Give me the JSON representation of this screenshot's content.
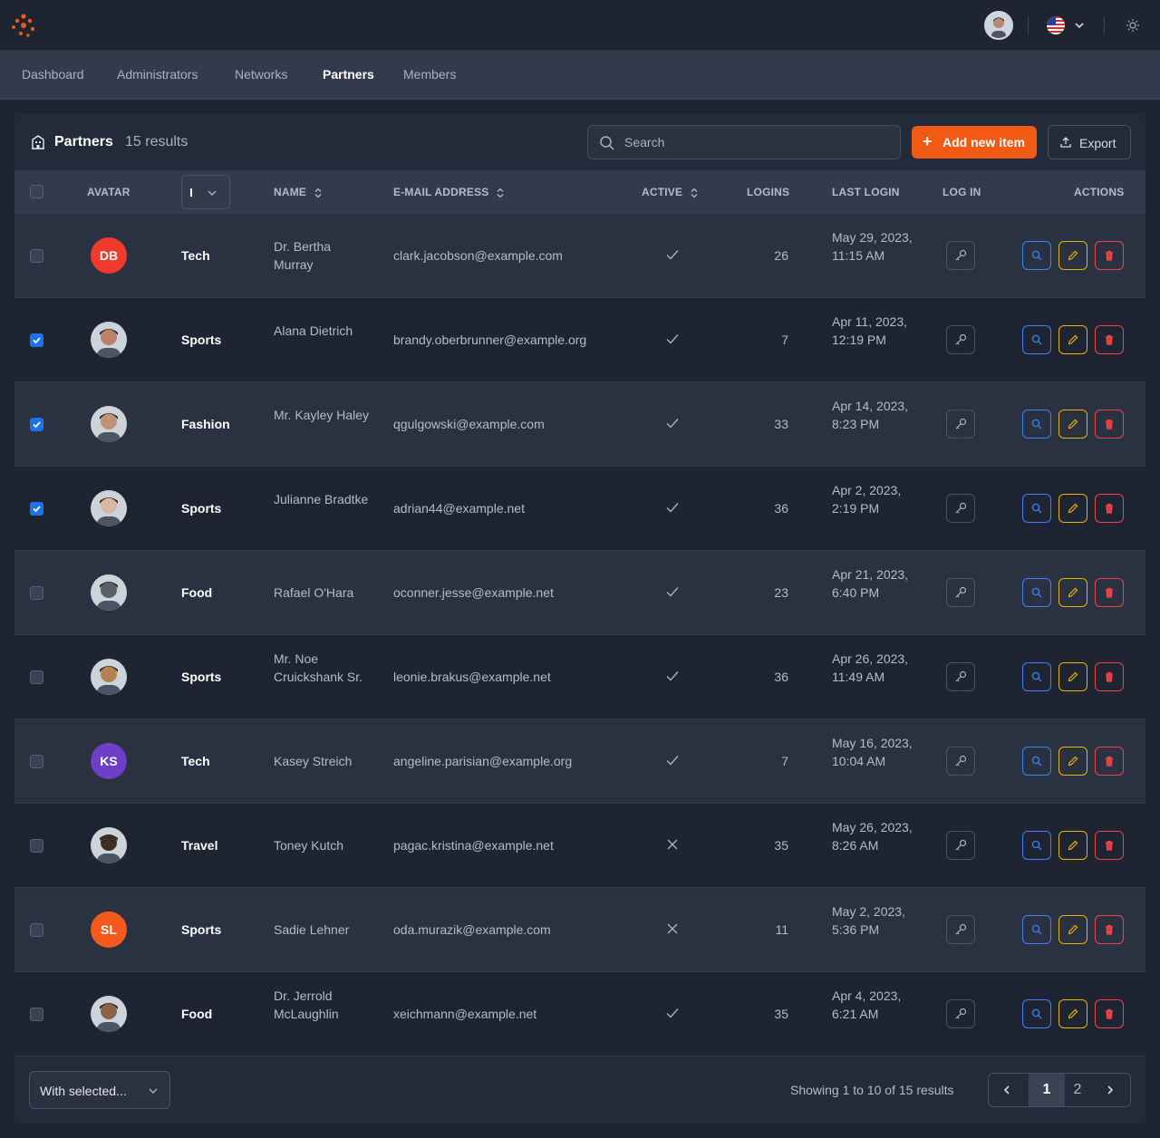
{
  "nav": {
    "items": [
      {
        "label": "Dashboard",
        "active": false
      },
      {
        "label": "Administrators",
        "active": false
      },
      {
        "label": "Networks",
        "active": false
      },
      {
        "label": "Partners",
        "active": true
      },
      {
        "label": "Members",
        "active": false
      }
    ]
  },
  "card": {
    "title": "Partners",
    "count": "15 results",
    "search_placeholder": "Search",
    "add_label": "Add new item",
    "export_label": "Export"
  },
  "columns": {
    "avatar": "AVATAR",
    "name": "NAME",
    "email": "E-MAIL ADDRESS",
    "active": "ACTIVE",
    "logins": "LOGINS",
    "last_login": "LAST LOGIN",
    "log_in": "LOG IN",
    "actions": "ACTIONS"
  },
  "rows": [
    {
      "checked": false,
      "avatar": {
        "type": "initials",
        "text": "DB",
        "color": "#ef3b2d"
      },
      "category": "Tech",
      "name": "Dr. Bertha Murray",
      "email": "clark.jacobson@example.com",
      "active": true,
      "logins": "26",
      "last_login": "May 29, 2023, 11:15 AM"
    },
    {
      "checked": true,
      "avatar": {
        "type": "photo",
        "color": "#b9826a"
      },
      "category": "Sports",
      "name": "Alana Dietrich",
      "email": "brandy.oberbrunner@example.org",
      "active": true,
      "logins": "7",
      "last_login": "Apr 11, 2023, 12:19 PM"
    },
    {
      "checked": true,
      "avatar": {
        "type": "photo",
        "color": "#c2917a"
      },
      "category": "Fashion",
      "name": "Mr. Kayley Haley",
      "email": "qgulgowski@example.com",
      "active": true,
      "logins": "33",
      "last_login": "Apr 14, 2023, 8:23 PM"
    },
    {
      "checked": true,
      "avatar": {
        "type": "photo",
        "color": "#d9b8a4"
      },
      "category": "Sports",
      "name": "Julianne Bradtke",
      "email": "adrian44@example.net",
      "active": true,
      "logins": "36",
      "last_login": "Apr 2, 2023, 2:19 PM"
    },
    {
      "checked": false,
      "avatar": {
        "type": "photo",
        "color": "#5b6068"
      },
      "category": "Food",
      "name": "Rafael O'Hara",
      "email": "oconner.jesse@example.net",
      "active": true,
      "logins": "23",
      "last_login": "Apr 21, 2023, 6:40 PM"
    },
    {
      "checked": false,
      "avatar": {
        "type": "photo",
        "color": "#b7814f"
      },
      "category": "Sports",
      "name": "Mr. Noe Cruickshank Sr.",
      "email": "leonie.brakus@example.net",
      "active": true,
      "logins": "36",
      "last_login": "Apr 26, 2023, 11:49 AM"
    },
    {
      "checked": false,
      "avatar": {
        "type": "initials",
        "text": "KS",
        "color": "#6d3fc6"
      },
      "category": "Tech",
      "name": "Kasey Streich",
      "email": "angeline.parisian@example.org",
      "active": true,
      "logins": "7",
      "last_login": "May 16, 2023, 10:04 AM"
    },
    {
      "checked": false,
      "avatar": {
        "type": "photo",
        "color": "#3a2d24"
      },
      "category": "Travel",
      "name": "Toney Kutch",
      "email": "pagac.kristina@example.net",
      "active": false,
      "logins": "35",
      "last_login": "May 26, 2023, 8:26 AM"
    },
    {
      "checked": false,
      "avatar": {
        "type": "initials",
        "text": "SL",
        "color": "#f45a1d"
      },
      "category": "Sports",
      "name": "Sadie Lehner",
      "email": "oda.murazik@example.com",
      "active": false,
      "logins": "11",
      "last_login": "May 2, 2023, 5:36 PM"
    },
    {
      "checked": false,
      "avatar": {
        "type": "photo",
        "color": "#8a6046"
      },
      "category": "Food",
      "name": "Dr. Jerrold McLaughlin",
      "email": "xeichmann@example.net",
      "active": true,
      "logins": "35",
      "last_login": "Apr 4, 2023, 6:21 AM"
    }
  ],
  "footer": {
    "bulk_label": "With selected...",
    "showing": "Showing 1 to 10 of 15 results",
    "pages": [
      "1",
      "2"
    ],
    "current_page": "1"
  },
  "colors": {
    "accent": "#f05a14",
    "view": "#3b82f6",
    "edit": "#eab308",
    "delete": "#ef4444",
    "checkbox": "#1a73e8"
  }
}
